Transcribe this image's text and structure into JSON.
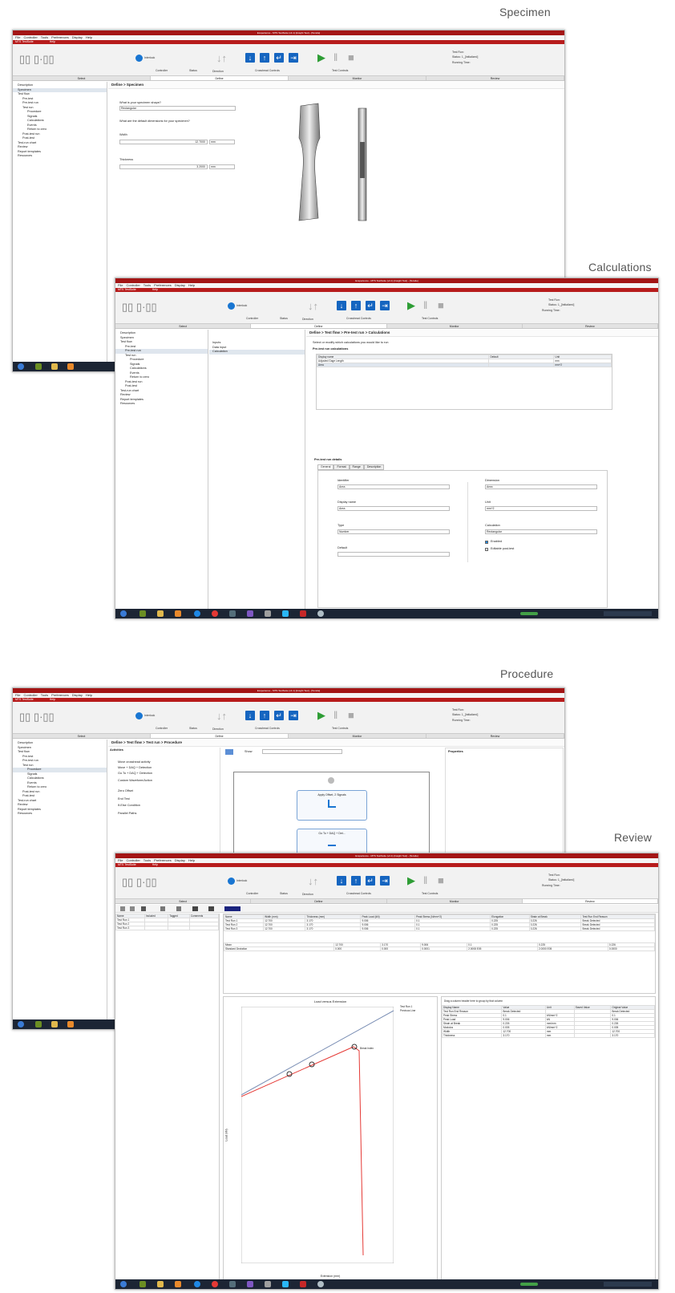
{
  "captions": {
    "specimen": "Specimen",
    "calculations": "Calculations",
    "procedure": "Procedure",
    "review": "Review"
  },
  "app": {
    "window_title": "Exsperience - MTS TestSuite (v4.1) [Insight Test] - [Tensile]",
    "menu": [
      "File",
      "Controller",
      "Tools",
      "Preferences",
      "Display",
      "Help"
    ],
    "app_tab": "MTS TestSuite",
    "app_tab_extra": "Help",
    "ribbon": {
      "interlock": "Interlock",
      "controller": "Controller",
      "status": "Status",
      "direction": "Direction",
      "crosshead_controls": "Crosshead Controls",
      "test_controls": "Test Controls",
      "test_run": "Test Run:",
      "test_status": "Status: 1_[Initialized]",
      "running_time": "Running Time:"
    },
    "workflow_tabs": [
      "Select",
      "Define",
      "Monitor",
      "Review"
    ],
    "nav_tree": [
      "Description",
      "Specimen",
      "Test flow",
      "Pre-test",
      "Pre-test run",
      "Test run",
      "Procedure",
      "Signals",
      "Calculations",
      "Events",
      "Return to zero",
      "Post-test run",
      "Post-test",
      "Test-run chart",
      "Review",
      "Report templates",
      "Resources"
    ]
  },
  "specimen": {
    "breadcrumb": "Define > Specimen",
    "shape_question": "What is your specimen shape?",
    "shape_value": "Rectangular",
    "dims_question": "What are the default dimensions for your specimen?",
    "width_label": "Width",
    "width_value": "12.7000",
    "width_unit": "mm",
    "thickness_label": "Thickness",
    "thickness_value": "3.2000",
    "thickness_unit": "mm"
  },
  "calculations": {
    "breadcrumb": "Define > Test flow > Pre-test run > Calculations",
    "list": [
      "Inputs",
      "Data input",
      "Calculation"
    ],
    "prompt": "Select or modify which calculations you would like to run",
    "pre_test_heading": "Pre-test run calculations",
    "columns": [
      "Display name",
      "Default",
      "Unit"
    ],
    "rows": [
      [
        "Adjusted Gage Length",
        "",
        "mm"
      ],
      [
        "Area",
        "",
        "mm^2"
      ]
    ],
    "details_heading": "Pre-test run details",
    "detail_tabs": [
      "General",
      "Format",
      "Range",
      "Description"
    ],
    "identifier_label": "Identifier",
    "identifier_value": "Area",
    "display_name_label": "Display name",
    "display_name_value": "Area",
    "type_label": "Type",
    "type_value": "Number",
    "default_label": "Default",
    "dimension_label": "Dimension",
    "dimension_value": "Area",
    "unit_label": "Unit",
    "unit_value": "mm^2",
    "calc_label": "Calculation",
    "calc_value": "Rectangular",
    "enabled_label": "Enabled",
    "editable_label": "Editable post-test"
  },
  "procedure": {
    "breadcrumb": "Define > Test flow > Test run > Procedure",
    "palette_title": "Activities",
    "palette": [
      "Move crosshead activity",
      "Move + DAQ + Detection",
      "Go To + DAQ + Detection",
      "Custom Waveform/Action",
      "Zero Offset",
      "End Test",
      "If-Else Condition",
      "Parallel Paths"
    ],
    "zoom_label": "Show",
    "properties_title": "Properties",
    "node1": "Apply Offset, 2 Signals",
    "node2": "Go To + DAQ + Det..."
  },
  "review": {
    "left_columns": [
      "Name",
      "Included",
      "Tagged",
      "Comments"
    ],
    "left_rows": [
      "Test Run 1",
      "Test Run 2",
      "Test Run 3"
    ],
    "columns": [
      "Name",
      "Width (mm)",
      "Thickness (mm)",
      "Peak Load (kN)",
      "Peak Stress (N/mm^2)",
      "Elongation",
      "Strain at Break",
      "Test Run End Reason"
    ],
    "rows": [
      [
        "Test Run 1",
        "12.700",
        "3.170",
        "9.006",
        "0.1",
        "0.225",
        "0.226",
        "Break Detected"
      ],
      [
        "Test Run 2",
        "12.700",
        "3.170",
        "9.006",
        "0.1",
        "0.225",
        "0.226",
        "Break Detected"
      ],
      [
        "Test Run 3",
        "12.700",
        "3.170",
        "9.006",
        "0.1",
        "0.225",
        "0.226",
        "Break Detected"
      ]
    ],
    "stats": [
      [
        "Mean",
        "12.700",
        "3.170",
        "9.006",
        "0.1",
        "0.225",
        "0.226"
      ],
      [
        "Standard Deviation",
        "0.000",
        "0.000",
        "0.0001",
        "2.0008 E05",
        "2.0000 E05",
        "0.0000"
      ]
    ],
    "chart_title": "Load versus Extension",
    "chart_xlabel": "Extension (mm)",
    "chart_ylabel": "Load (kN)",
    "chart_legend": [
      "Test Run 1",
      "Previous Line"
    ],
    "chart_note": "Break Index",
    "props_hint": "Drag a column header here to group by that column",
    "props_columns": [
      "Display Name",
      "Value",
      "Unit",
      "Saved Value",
      "Original Value"
    ],
    "props_rows": [
      [
        "Test Run End Reason",
        "Break Detected",
        "",
        "",
        "Break Detected"
      ],
      [
        "Peak Stress",
        "0.1",
        "kN/mm^2",
        "",
        "0.1"
      ],
      [
        "Peak Load",
        "9.006",
        "kN",
        "",
        "9.006"
      ],
      [
        "Strain at Break",
        "0.226",
        "mm/mm",
        "",
        "0.226"
      ],
      [
        "Modulus",
        "0.005",
        "kN/mm^2",
        "",
        "0.005"
      ],
      [
        "Width",
        "12.700",
        "mm",
        "",
        "12.700"
      ],
      [
        "Thickness",
        "3.170",
        "mm",
        "",
        "3.170"
      ]
    ]
  }
}
